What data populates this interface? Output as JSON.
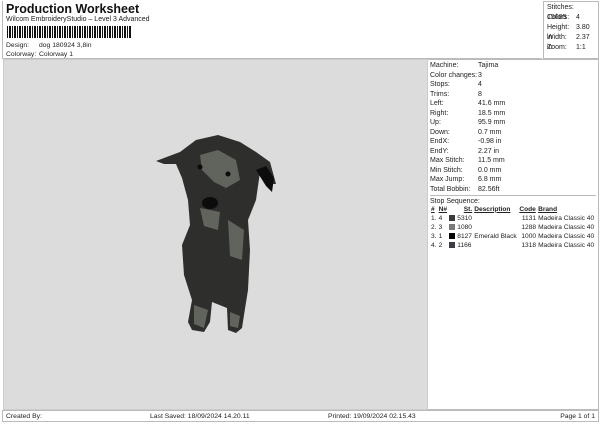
{
  "header": {
    "title": "Production Worksheet",
    "subtitle": "Wilcom EmbroideryStudio – Level 3 Advanced",
    "design_label": "Design:",
    "design": "dog 180924 3,8in",
    "colorway_label": "Colorway:",
    "colorway": "Colorway 1"
  },
  "stats": [
    {
      "label": "Stitches:",
      "value": "15685"
    },
    {
      "label": "Colors:",
      "value": "4"
    },
    {
      "label": "Height:",
      "value": "3.80 in"
    },
    {
      "label": "Width:",
      "value": "2.37 in"
    },
    {
      "label": "Zoom:",
      "value": "1:1"
    }
  ],
  "info": [
    {
      "label": "Machine:",
      "value": "Tajima"
    },
    {
      "label": "Color changes:",
      "value": "3"
    },
    {
      "label": "Stops:",
      "value": "4"
    },
    {
      "label": "Trims:",
      "value": "8"
    },
    {
      "label": "Left:",
      "value": "41.6 mm"
    },
    {
      "label": "Right:",
      "value": "18.5 mm"
    },
    {
      "label": "Up:",
      "value": "95.9 mm"
    },
    {
      "label": "Down:",
      "value": "0.7 mm"
    },
    {
      "label": "EndX:",
      "value": "-0.98 in"
    },
    {
      "label": "EndY:",
      "value": "2.27 in"
    },
    {
      "label": "Max Stitch:",
      "value": "11.5 mm"
    },
    {
      "label": "Min Stitch:",
      "value": "0.0 mm"
    },
    {
      "label": "Max Jump:",
      "value": "6.8 mm"
    },
    {
      "label": "Total Bobbin:",
      "value": "82.56ft"
    }
  ],
  "stop_sequence": {
    "title": "Stop Sequence:",
    "headers": [
      "#",
      "N#",
      "St.",
      "Description",
      "Code",
      "Brand"
    ],
    "rows": [
      {
        "n": "1.",
        "nn": "4",
        "color": "#3a3a3a",
        "st": "5310",
        "desc": "",
        "code": "1131",
        "brand": "Madeira Classic 40"
      },
      {
        "n": "2.",
        "nn": "3",
        "color": "#7a7a7a",
        "st": "1080",
        "desc": "",
        "code": "1288",
        "brand": "Madeira Classic 40"
      },
      {
        "n": "3.",
        "nn": "1",
        "color": "#050505",
        "st": "8127",
        "desc": "Emerald Black",
        "code": "1000",
        "brand": "Madeira Classic 40"
      },
      {
        "n": "4.",
        "nn": "2",
        "color": "#3c3c46",
        "st": "1166",
        "desc": "",
        "code": "1318",
        "brand": "Madeira Classic 40"
      }
    ]
  },
  "footer": {
    "created": "Created By:",
    "saved": "Last Saved: 18/09/2024 14.20.11",
    "printed": "Printed: 19/09/2024 02.15.43",
    "page": "Page 1 of 1"
  }
}
